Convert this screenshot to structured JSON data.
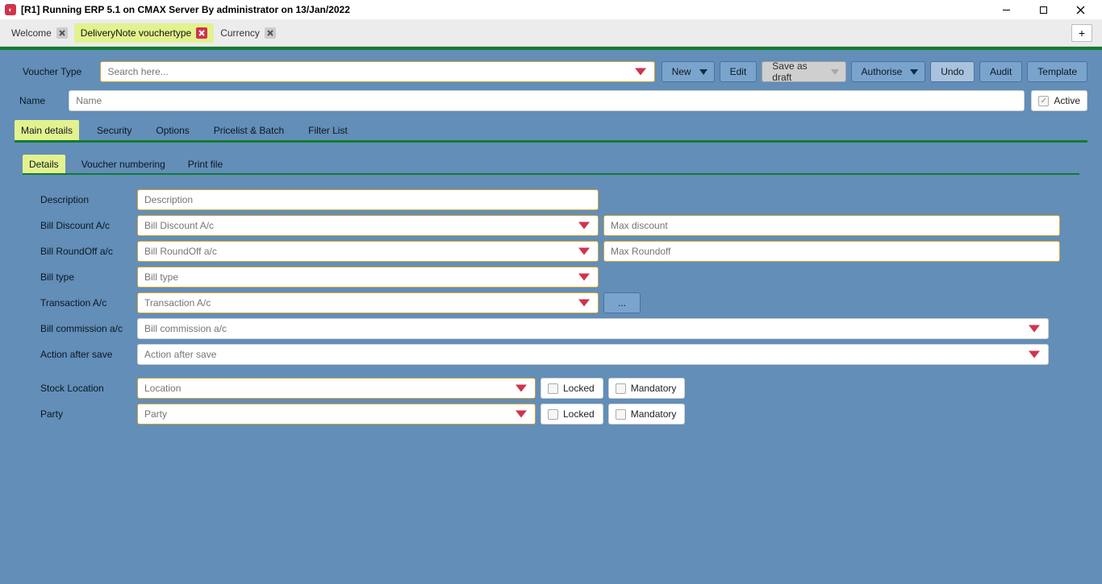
{
  "window": {
    "title": "[R1] Running ERP 5.1 on CMAX Server By administrator on 13/Jan/2022"
  },
  "tabs": {
    "items": [
      {
        "label": "Welcome",
        "closable": "gray",
        "active": false
      },
      {
        "label": "DeliveryNote vouchertype",
        "closable": "red",
        "active": true
      },
      {
        "label": "Currency",
        "closable": "gray",
        "active": false
      }
    ],
    "add": "+"
  },
  "toolbar": {
    "voucher_type_label": "Voucher Type",
    "search_placeholder": "Search here...",
    "new": "New",
    "edit": "Edit",
    "save_draft": "Save as draft",
    "authorise": "Authorise",
    "undo": "Undo",
    "audit": "Audit",
    "template": "Template"
  },
  "name_row": {
    "label": "Name",
    "placeholder": "Name",
    "active_label": "Active"
  },
  "tabs1": [
    "Main details",
    "Security",
    "Options",
    "Pricelist & Batch",
    "Filter List"
  ],
  "tabs2": [
    "Details",
    "Voucher numbering",
    "Print file"
  ],
  "details": {
    "description": {
      "label": "Description",
      "placeholder": "Description"
    },
    "bill_discount": {
      "label": "Bill Discount A/c",
      "placeholder": "Bill Discount A/c",
      "aux_placeholder": "Max discount"
    },
    "bill_roundoff": {
      "label": "Bill RoundOff a/c",
      "placeholder": "Bill RoundOff a/c",
      "aux_placeholder": "Max Roundoff"
    },
    "bill_type": {
      "label": "Bill type",
      "placeholder": "Bill type"
    },
    "transaction_ac": {
      "label": "Transaction A/c",
      "placeholder": "Transaction A/c",
      "more": "..."
    },
    "bill_commission": {
      "label": "Bill commission a/c",
      "placeholder": "Bill commission a/c"
    },
    "action_after_save": {
      "label": "Action after save",
      "placeholder": "Action after save"
    },
    "stock_location": {
      "label": "Stock Location",
      "placeholder": "Location",
      "locked": "Locked",
      "mandatory": "Mandatory"
    },
    "party": {
      "label": "Party",
      "placeholder": "Party",
      "locked": "Locked",
      "mandatory": "Mandatory"
    }
  }
}
